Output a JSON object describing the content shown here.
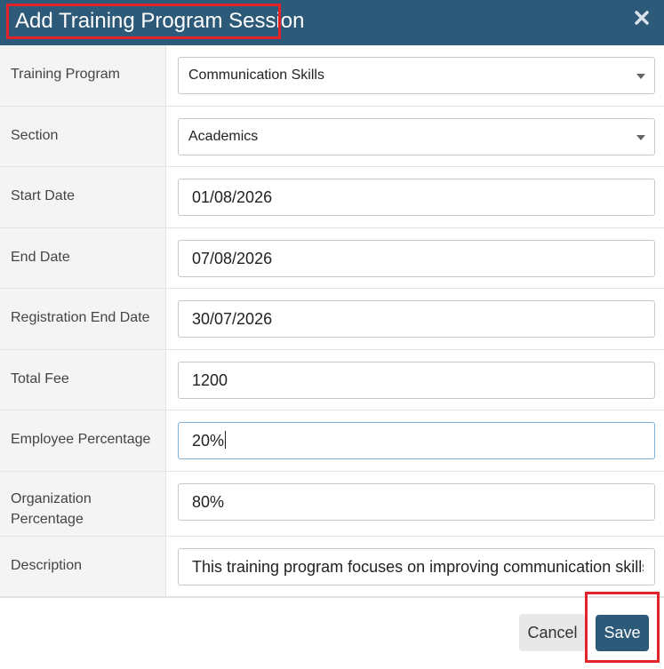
{
  "dialog": {
    "title": "Add Training Program Session",
    "close_icon": "close-icon"
  },
  "fields": {
    "training_program": {
      "label": "Training Program",
      "value": "Communication Skills"
    },
    "section": {
      "label": "Section",
      "value": "Academics"
    },
    "start_date": {
      "label": "Start Date",
      "value": "01/08/2026"
    },
    "end_date": {
      "label": "End Date",
      "value": "07/08/2026"
    },
    "registration_end_date": {
      "label": "Registration End Date",
      "value": "30/07/2026"
    },
    "total_fee": {
      "label": "Total Fee",
      "value": "1200"
    },
    "employee_percentage": {
      "label": "Employee Percentage",
      "value": "20%"
    },
    "organization_percentage": {
      "label": "Organization Percentage",
      "value": "80%"
    },
    "description": {
      "label": "Description",
      "value": "This training program focuses on improving communication skills"
    }
  },
  "footer": {
    "cancel_label": "Cancel",
    "save_label": "Save"
  },
  "colors": {
    "header": "#2e5a7a",
    "highlight": "#e3222a",
    "save_button": "#2e5a7a"
  }
}
